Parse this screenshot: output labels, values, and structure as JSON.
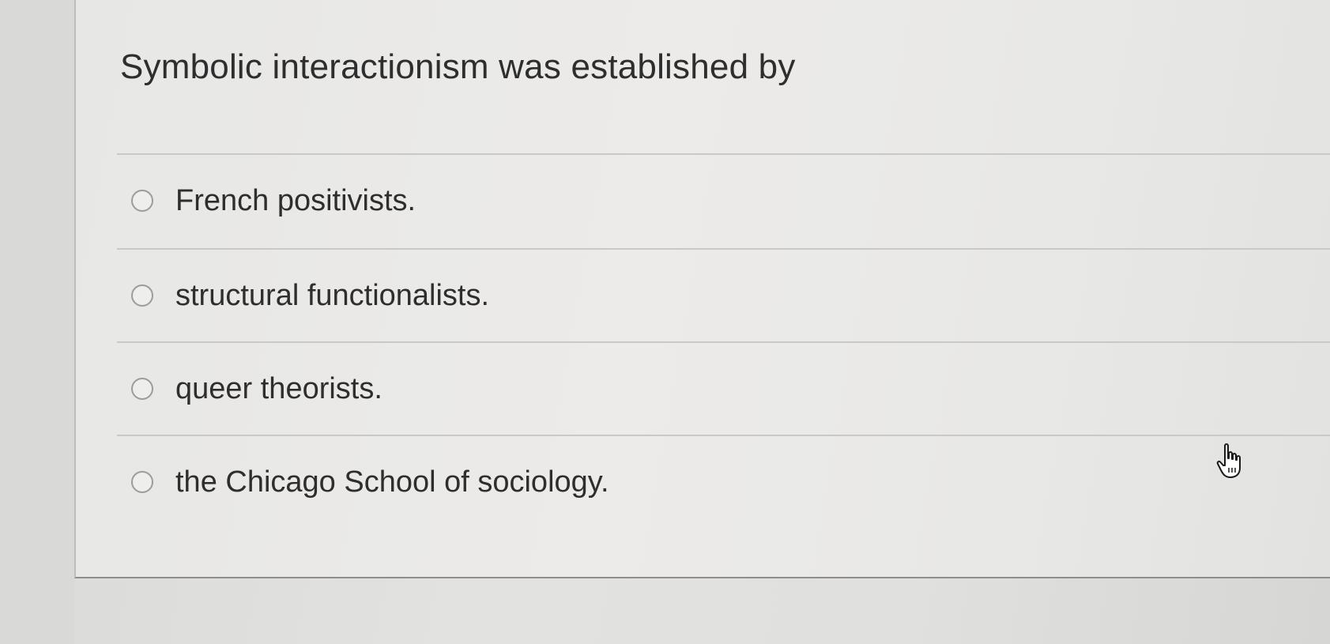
{
  "question": {
    "text": "Symbolic interactionism was established by"
  },
  "options": [
    {
      "label": "French positivists.",
      "selected": false
    },
    {
      "label": "structural functionalists.",
      "selected": false
    },
    {
      "label": "queer theorists.",
      "selected": false
    },
    {
      "label": "the Chicago School of sociology.",
      "selected": false
    }
  ],
  "cursor": {
    "icon": "hand-pointer-icon"
  }
}
